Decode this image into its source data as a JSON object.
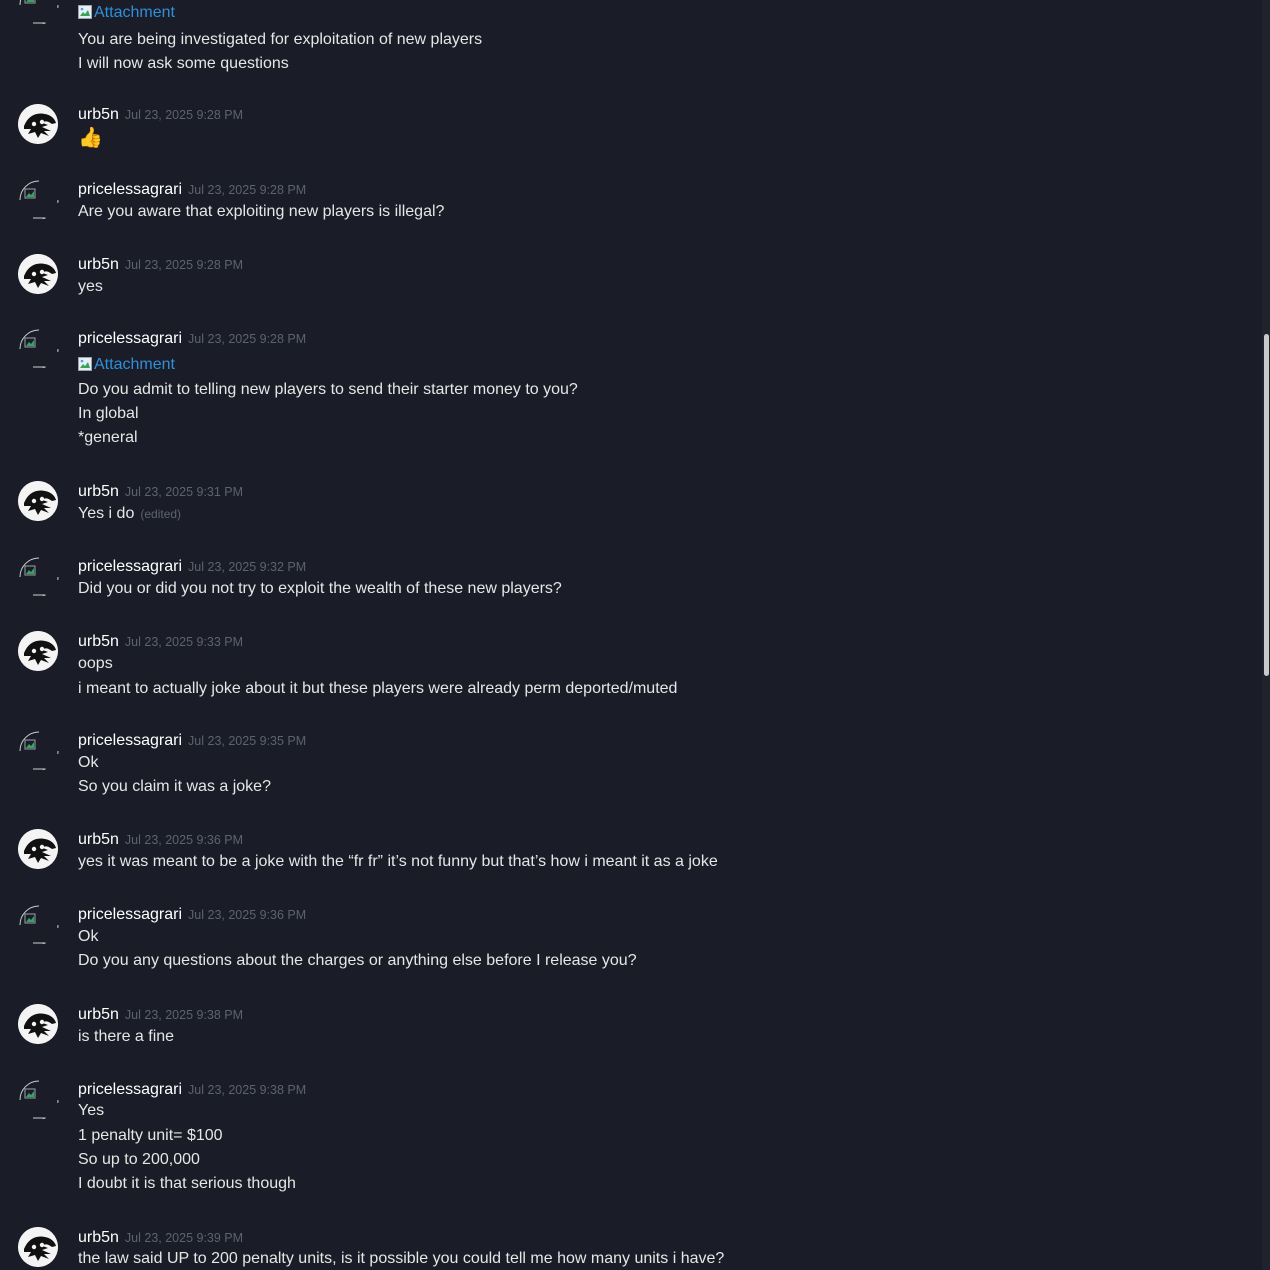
{
  "messages": [
    {
      "user": "",
      "timestamp": "",
      "attachment": "Attachment",
      "lines": [
        "You are being investigated for exploitation of new players",
        "I will now ask some questions"
      ]
    },
    {
      "user": "urb5n",
      "timestamp": "Jul 23, 2025 9:28 PM",
      "emoji": "👍"
    },
    {
      "user": "pricelessagrari",
      "timestamp": "Jul 23, 2025 9:28 PM",
      "lines": [
        "Are you aware that exploiting new players is illegal?"
      ]
    },
    {
      "user": "urb5n",
      "timestamp": "Jul 23, 2025 9:28 PM",
      "lines": [
        "yes"
      ]
    },
    {
      "user": "pricelessagrari",
      "timestamp": "Jul 23, 2025 9:28 PM",
      "attachment": "Attachment",
      "lines": [
        "Do you admit to telling new players to send their starter money to you?",
        "In global",
        "*general"
      ]
    },
    {
      "user": "urb5n",
      "timestamp": "Jul 23, 2025 9:31 PM",
      "lines": [
        "Yes i do"
      ],
      "edited": "(edited)"
    },
    {
      "user": "pricelessagrari",
      "timestamp": "Jul 23, 2025 9:32 PM",
      "lines": [
        "Did you or did you not try to exploit the wealth of these new players?"
      ]
    },
    {
      "user": "urb5n",
      "timestamp": "Jul 23, 2025 9:33 PM",
      "lines": [
        "oops",
        "i meant to actually joke about it but these players were already perm deported/muted"
      ]
    },
    {
      "user": "pricelessagrari",
      "timestamp": "Jul 23, 2025 9:35 PM",
      "lines": [
        "Ok",
        "So you claim it was a joke?"
      ]
    },
    {
      "user": "urb5n",
      "timestamp": "Jul 23, 2025 9:36 PM",
      "lines": [
        "yes it was meant to be a joke with the “fr fr” it’s not funny but that’s how i meant it as a joke"
      ]
    },
    {
      "user": "pricelessagrari",
      "timestamp": "Jul 23, 2025 9:36 PM",
      "lines": [
        "Ok",
        "Do you any questions about the charges or anything else before I release you?"
      ]
    },
    {
      "user": "urb5n",
      "timestamp": "Jul 23, 2025 9:38 PM",
      "lines": [
        "is there a fine"
      ]
    },
    {
      "user": "pricelessagrari",
      "timestamp": "Jul 23, 2025 9:38 PM",
      "lines": [
        "Yes",
        "1 penalty unit= $100",
        "So up to 200,000",
        "I doubt it is that serious though"
      ]
    },
    {
      "user": "urb5n",
      "timestamp": "Jul 23, 2025 9:39 PM",
      "lines": [
        "the law said UP to 200 penalty units, is it possible you could tell me how many units i have?"
      ]
    }
  ],
  "colors": {
    "background": "#1a1d27",
    "username": "#ffffff",
    "timestamp": "#5d6270",
    "message_text": "#e6e6e6",
    "link": "#2f8fd8",
    "scroll_thumb": "#c9c9c9"
  }
}
